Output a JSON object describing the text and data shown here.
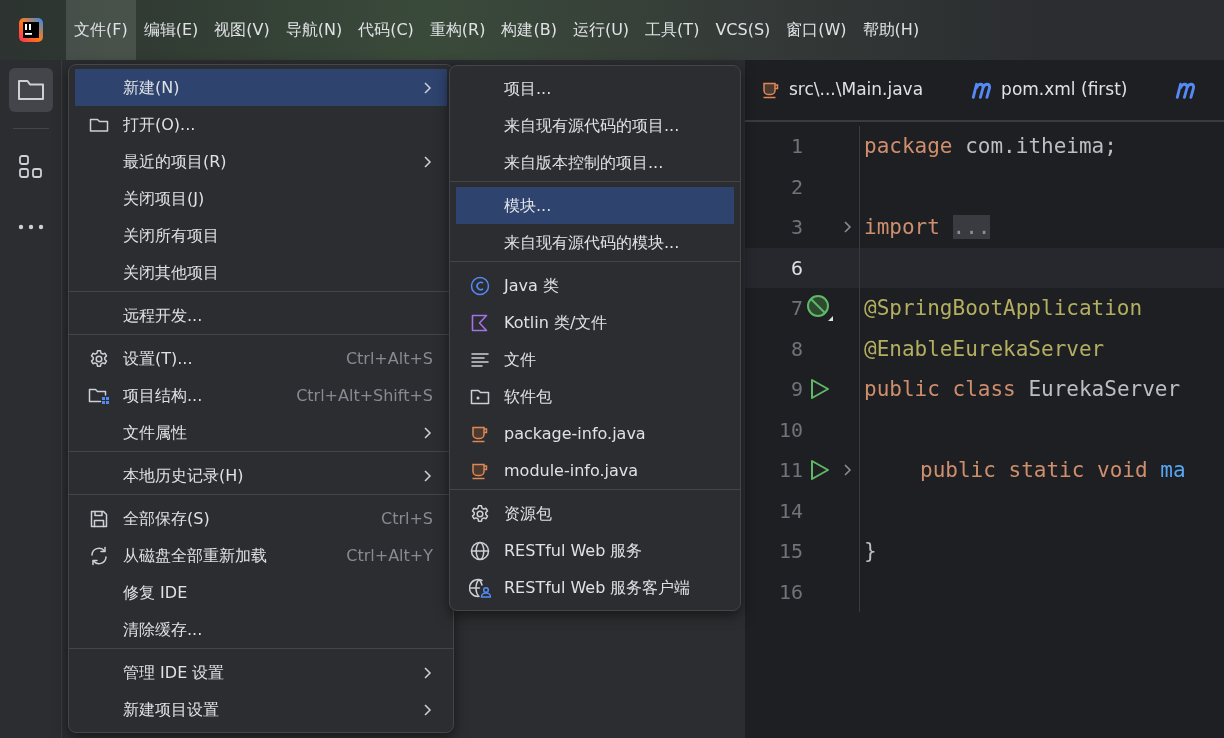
{
  "menu_bar": [
    {
      "label": "文件(F)",
      "selected": true
    },
    {
      "label": "编辑(E)",
      "selected": false
    },
    {
      "label": "视图(V)",
      "selected": false
    },
    {
      "label": "导航(N)",
      "selected": false
    },
    {
      "label": "代码(C)",
      "selected": false
    },
    {
      "label": "重构(R)",
      "selected": false
    },
    {
      "label": "构建(B)",
      "selected": false
    },
    {
      "label": "运行(U)",
      "selected": false
    },
    {
      "label": "工具(T)",
      "selected": false
    },
    {
      "label": "VCS(S)",
      "selected": false
    },
    {
      "label": "窗口(W)",
      "selected": false
    },
    {
      "label": "帮助(H)",
      "selected": false
    }
  ],
  "tool_strip": [
    {
      "selected": true
    },
    {
      "selected": false
    },
    {
      "selected": false
    }
  ],
  "editor_tabs": [
    {
      "kind": "java",
      "label": "src\\...\\Main.java"
    },
    {
      "kind": "maven",
      "label": "pom.xml (first)"
    },
    {
      "kind": "maven"
    }
  ],
  "code_lines": [
    {
      "number": "1",
      "current": false,
      "fold": false,
      "indented": false,
      "tokens": [
        {
          "kind": "keyword",
          "text": "package"
        },
        {
          "kind": "plain",
          "text": "com.itheima;"
        }
      ]
    },
    {
      "number": "2",
      "current": false,
      "fold": false
    },
    {
      "number": "3",
      "current": false,
      "fold": true,
      "indented": false,
      "tokens": [
        {
          "kind": "keyword",
          "text": "import"
        },
        {
          "kind": "folded",
          "text": "..."
        }
      ]
    },
    {
      "number": "6",
      "current": true,
      "fold": false
    },
    {
      "number": "7",
      "kind": "spring",
      "current": false,
      "fold": false,
      "indented": false,
      "tokens": [
        {
          "kind": "annotation",
          "text": "@SpringBootApplication"
        }
      ]
    },
    {
      "number": "8",
      "current": false,
      "fold": false,
      "indented": false,
      "tokens": [
        {
          "kind": "annotation",
          "text": "@EnableEurekaServer"
        }
      ]
    },
    {
      "number": "9",
      "kind": "run",
      "current": false,
      "fold": false,
      "indented": false,
      "tokens": [
        {
          "kind": "keyword",
          "text": "public class"
        },
        {
          "kind": "plain",
          "text": "EurekaServer"
        }
      ]
    },
    {
      "number": "10",
      "current": false,
      "fold": false
    },
    {
      "number": "11",
      "kind": "run",
      "current": false,
      "fold": true,
      "indented": true,
      "tokens": [
        {
          "kind": "keyword",
          "text": "public static void"
        },
        {
          "kind": "method",
          "text": "ma"
        }
      ]
    },
    {
      "number": "14",
      "current": false,
      "fold": false
    },
    {
      "number": "15",
      "current": false,
      "fold": false,
      "indented": false,
      "tokens": [
        {
          "kind": "plain",
          "text": "}"
        }
      ]
    },
    {
      "number": "16",
      "current": false,
      "fold": false
    }
  ],
  "file_menu": [
    {
      "label": "新建(N)",
      "submenu": true,
      "selected": true,
      "separator_before": false
    },
    {
      "label": "打开(O)...",
      "kind": "folder",
      "submenu": false,
      "selected": false,
      "separator_before": false
    },
    {
      "label": "最近的项目(R)",
      "submenu": true,
      "selected": false,
      "separator_before": false
    },
    {
      "label": "关闭项目(J)",
      "submenu": false,
      "selected": false,
      "separator_before": false
    },
    {
      "label": "关闭所有项目",
      "submenu": false,
      "selected": false,
      "separator_before": false
    },
    {
      "label": "关闭其他项目",
      "submenu": false,
      "selected": false,
      "separator_before": false
    },
    {
      "label": "远程开发...",
      "submenu": false,
      "selected": false,
      "separator_before": true
    },
    {
      "label": "设置(T)...",
      "kind": "gear",
      "shortcut": "Ctrl+Alt+S",
      "submenu": false,
      "selected": false,
      "separator_before": true
    },
    {
      "label": "项目结构...",
      "kind": "structure",
      "shortcut": "Ctrl+Alt+Shift+S",
      "submenu": false,
      "selected": false,
      "separator_before": false
    },
    {
      "label": "文件属性",
      "submenu": true,
      "selected": false,
      "separator_before": false
    },
    {
      "label": "本地历史记录(H)",
      "submenu": true,
      "selected": false,
      "separator_before": true
    },
    {
      "label": "全部保存(S)",
      "kind": "save",
      "shortcut": "Ctrl+S",
      "submenu": false,
      "selected": false,
      "separator_before": true
    },
    {
      "label": "从磁盘全部重新加载",
      "kind": "reload",
      "shortcut": "Ctrl+Alt+Y",
      "submenu": false,
      "selected": false,
      "separator_before": false
    },
    {
      "label": "修复 IDE",
      "submenu": false,
      "selected": false,
      "separator_before": false
    },
    {
      "label": "清除缓存...",
      "submenu": false,
      "selected": false,
      "separator_before": false
    },
    {
      "label": "管理 IDE 设置",
      "submenu": true,
      "selected": false,
      "separator_before": true
    },
    {
      "label": "新建项目设置",
      "submenu": true,
      "selected": false,
      "separator_before": false
    }
  ],
  "new_submenu": [
    {
      "label": "项目...",
      "selected": false,
      "separator_before": false
    },
    {
      "label": "来自现有源代码的项目...",
      "selected": false,
      "separator_before": false
    },
    {
      "label": "来自版本控制的项目...",
      "selected": false,
      "separator_before": false
    },
    {
      "label": "模块...",
      "selected": true,
      "separator_before": true
    },
    {
      "label": "来自现有源代码的模块...",
      "selected": false,
      "separator_before": false
    },
    {
      "label": "Java 类",
      "kind": "class",
      "selected": false,
      "separator_before": true
    },
    {
      "label": "Kotlin 类/文件",
      "kind": "kotlin",
      "selected": false,
      "separator_before": false
    },
    {
      "label": "文件",
      "kind": "text",
      "selected": false,
      "separator_before": false
    },
    {
      "label": "软件包",
      "kind": "package",
      "selected": false,
      "separator_before": false
    },
    {
      "label": "package-info.java",
      "kind": "java",
      "selected": false,
      "separator_before": false
    },
    {
      "label": "module-info.java",
      "kind": "java",
      "selected": false,
      "separator_before": false
    },
    {
      "label": "资源包",
      "kind": "gear",
      "selected": false,
      "separator_before": true
    },
    {
      "label": "RESTful Web 服务",
      "kind": "globe",
      "selected": false,
      "separator_before": false
    },
    {
      "label": "RESTful Web 服务客户端",
      "kind": "client",
      "selected": false,
      "separator_before": false
    }
  ]
}
